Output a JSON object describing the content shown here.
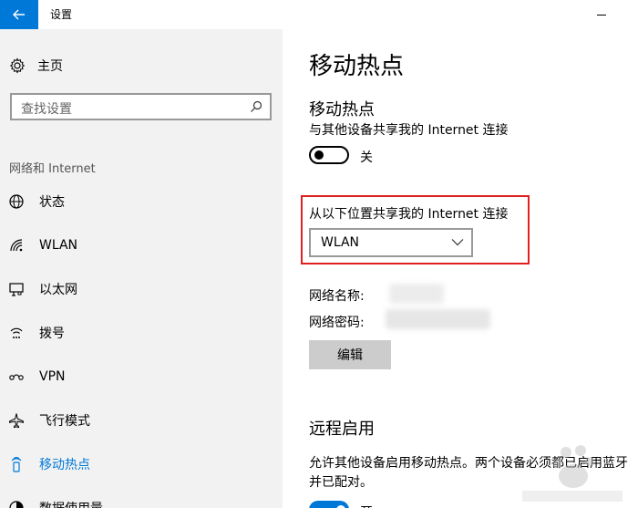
{
  "window": {
    "title": "设置"
  },
  "sidebar": {
    "home_label": "主页",
    "search_placeholder": "查找设置",
    "section_title": "网络和 Internet",
    "items": [
      {
        "label": "状态",
        "icon": "globe-icon"
      },
      {
        "label": "WLAN",
        "icon": "wifi-icon"
      },
      {
        "label": "以太网",
        "icon": "ethernet-icon"
      },
      {
        "label": "拨号",
        "icon": "dialup-icon"
      },
      {
        "label": "VPN",
        "icon": "vpn-icon"
      },
      {
        "label": "飞行模式",
        "icon": "airplane-icon"
      },
      {
        "label": "移动热点",
        "icon": "hotspot-icon",
        "active": true
      },
      {
        "label": "数据使用量",
        "icon": "data-usage-icon"
      }
    ]
  },
  "main": {
    "title": "移动热点",
    "hotspot_heading": "移动热点",
    "share_desc": "与其他设备共享我的 Internet 连接",
    "toggle_state": "关",
    "share_from_label": "从以下位置共享我的 Internet 连接",
    "share_from_value": "WLAN",
    "network_name_label": "网络名称:",
    "network_password_label": "网络密码:",
    "edit_button": "编辑",
    "remote_heading": "远程启用",
    "remote_desc": "允许其他设备启用移动热点。两个设备必须都已启用蓝牙并已配对。",
    "remote_toggle_state": "开"
  },
  "colors": {
    "accent": "#0078d7",
    "highlight": "#e02020",
    "sidebar_bg": "#f2f2f2"
  }
}
